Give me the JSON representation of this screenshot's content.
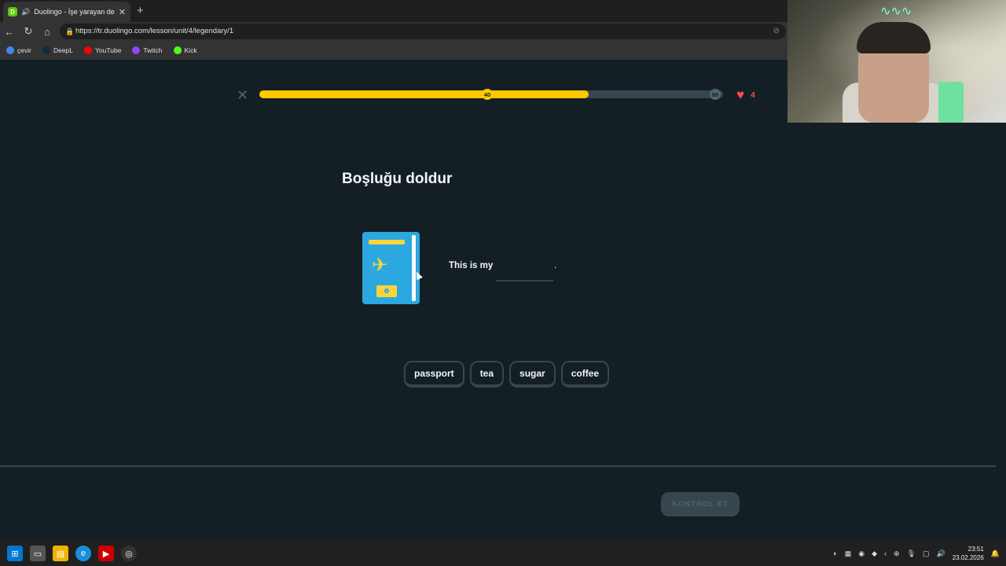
{
  "browser": {
    "tab_title": "Duolingo - İşe yarayan dersle",
    "tab_close": "✕",
    "new_tab": "+",
    "url": "https://tr.duolingo.com/lesson/unit/4/legendary/1",
    "bookmarks": [
      {
        "label": "çevir",
        "icon": "google-icon",
        "color": "#4285f4"
      },
      {
        "label": "DeepL",
        "icon": "deepl-icon",
        "color": "#0f2b46"
      },
      {
        "label": "YouTube",
        "icon": "youtube-icon",
        "color": "#ff0000"
      },
      {
        "label": "Twitch",
        "icon": "twitch-icon",
        "color": "#9146ff"
      },
      {
        "label": "Kick",
        "icon": "kick-icon",
        "color": "#53fc18"
      }
    ]
  },
  "lesson": {
    "progress_fraction": 0.71,
    "checkpoint_1": "40",
    "checkpoint_2": "80",
    "hearts": "4",
    "heading": "Boşluğu doldur",
    "sentence_start": "This is my",
    "sentence_end": ".",
    "word_bank": [
      "passport",
      "tea",
      "sugar",
      "coffee"
    ],
    "check_button": "KONTROL ET"
  },
  "taskbar": {
    "time": "23:51",
    "date": "23.02.2026"
  },
  "colors": {
    "background": "#131f24",
    "progress": "#ffc800",
    "heart": "#ff4b4b",
    "border": "#37464f"
  }
}
